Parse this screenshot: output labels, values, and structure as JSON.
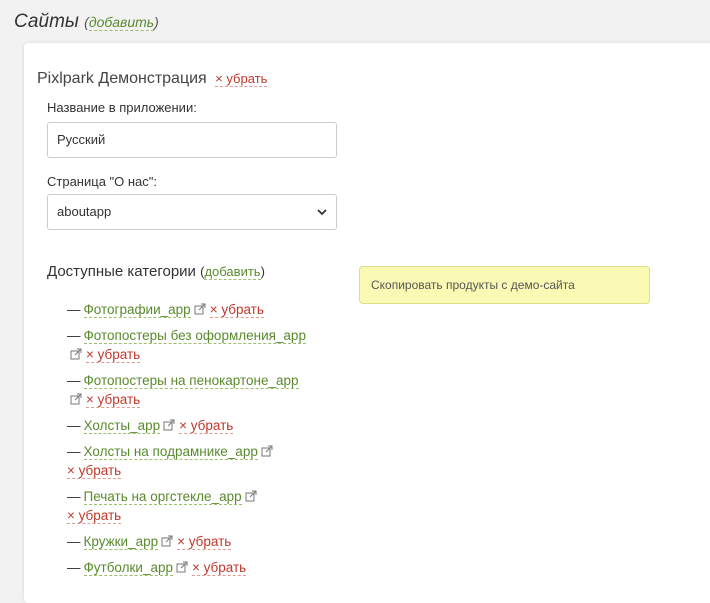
{
  "header": {
    "title": "Сайты",
    "add_link": "добавить"
  },
  "site": {
    "name": "Pixlpark Демонстрация",
    "remove_link": "× убрать",
    "app_name_label": "Название в приложении:",
    "app_name_value": "Русский",
    "about_label": "Страница \"О нас\":",
    "about_value": "aboutapp",
    "categories_label": "Доступные категории",
    "categories_add": "добавить",
    "copy_button": "Скопировать продукты с демо-сайта",
    "categories": [
      {
        "name": "Фотографии_app",
        "remove": "× убрать"
      },
      {
        "name": "Фотопостеры без оформления_app",
        "remove": "× убрать"
      },
      {
        "name": "Фотопостеры на пенокартоне_app",
        "remove": "× убрать"
      },
      {
        "name": "Холсты_app",
        "remove": "× убрать"
      },
      {
        "name": "Холсты на подрамнике_app",
        "remove": "× убрать"
      },
      {
        "name": "Печать на оргстекле_app",
        "remove": "× убрать"
      },
      {
        "name": "Кружки_app",
        "remove": "× убрать"
      },
      {
        "name": "Футболки_app",
        "remove": "× убрать"
      }
    ]
  },
  "colors": {
    "link_green": "#5a8a2e",
    "link_red": "#c0392b",
    "button_yellow": "#fafab4"
  },
  "icons": {
    "external": "external-link-icon",
    "select_chevron": "chevron-down-icon"
  }
}
